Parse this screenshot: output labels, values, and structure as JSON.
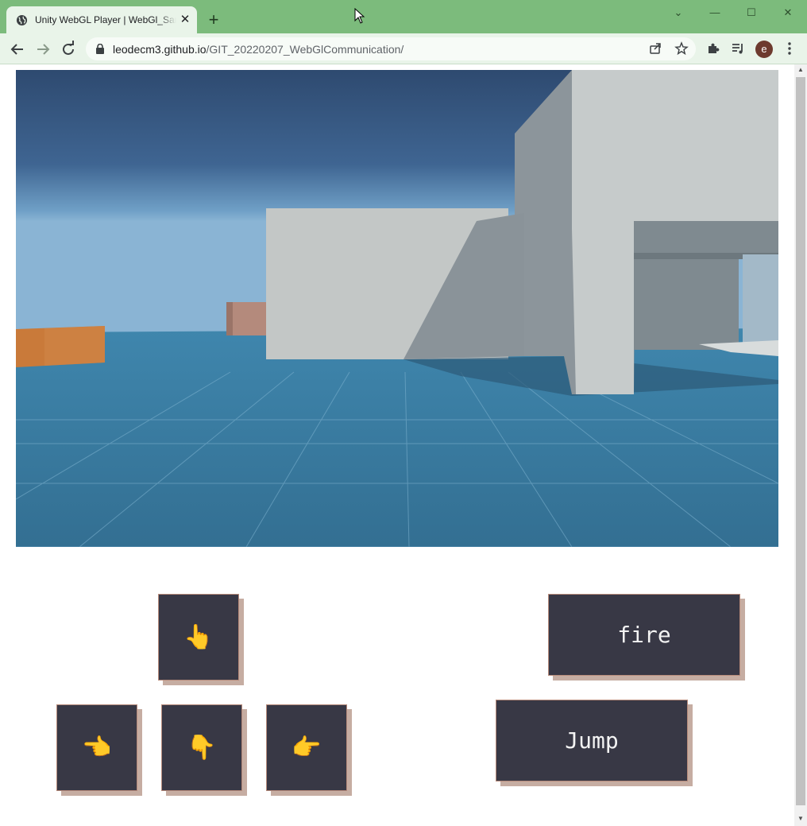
{
  "browser": {
    "tab": {
      "title": "Unity WebGL Player | WebGl_Sam",
      "close": "✕"
    },
    "new_tab": "+",
    "window_controls": {
      "dropdown": "⌄",
      "minimize": "—",
      "maximize": "☐",
      "close": "✕"
    },
    "address": {
      "host": "leodecm3.github.io",
      "path": "/GIT_20220207_WebGlCommunication/"
    },
    "profile_initial": "e"
  },
  "controls": {
    "up": "👆",
    "left": "👈",
    "down": "👇",
    "right": "👉",
    "fire": "fire",
    "jump": "Jump"
  },
  "colors": {
    "chrome_frame": "#7cbb7c",
    "toolbar": "#e9f4e9",
    "button_bg": "#383845",
    "button_shadow": "#c6ada2",
    "sky_top": "#2e4a70",
    "floor": "#3a7898"
  }
}
